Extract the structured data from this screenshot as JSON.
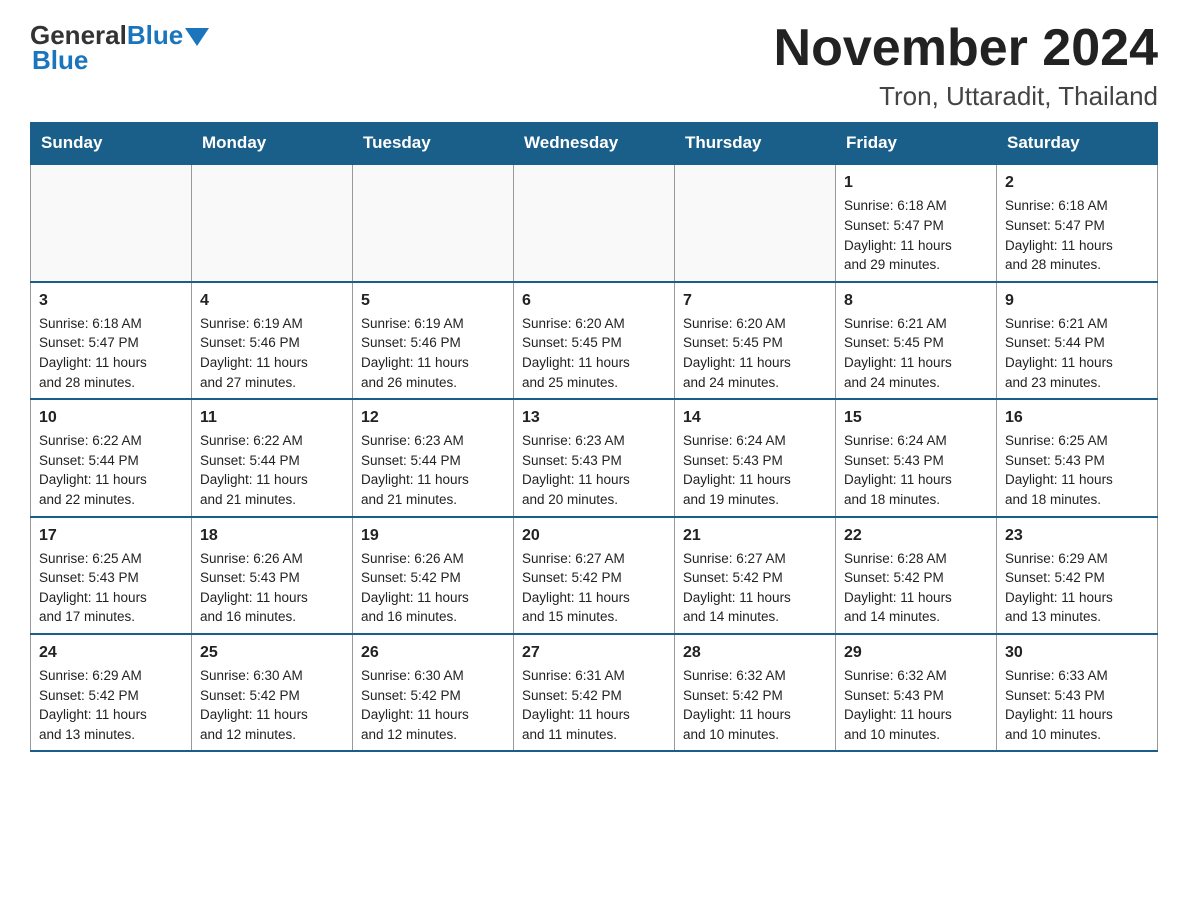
{
  "header": {
    "logo_general": "General",
    "logo_blue": "Blue",
    "month_title": "November 2024",
    "location": "Tron, Uttaradit, Thailand"
  },
  "days_of_week": [
    "Sunday",
    "Monday",
    "Tuesday",
    "Wednesday",
    "Thursday",
    "Friday",
    "Saturday"
  ],
  "weeks": [
    [
      {
        "day": "",
        "info": ""
      },
      {
        "day": "",
        "info": ""
      },
      {
        "day": "",
        "info": ""
      },
      {
        "day": "",
        "info": ""
      },
      {
        "day": "",
        "info": ""
      },
      {
        "day": "1",
        "info": "Sunrise: 6:18 AM\nSunset: 5:47 PM\nDaylight: 11 hours\nand 29 minutes."
      },
      {
        "day": "2",
        "info": "Sunrise: 6:18 AM\nSunset: 5:47 PM\nDaylight: 11 hours\nand 28 minutes."
      }
    ],
    [
      {
        "day": "3",
        "info": "Sunrise: 6:18 AM\nSunset: 5:47 PM\nDaylight: 11 hours\nand 28 minutes."
      },
      {
        "day": "4",
        "info": "Sunrise: 6:19 AM\nSunset: 5:46 PM\nDaylight: 11 hours\nand 27 minutes."
      },
      {
        "day": "5",
        "info": "Sunrise: 6:19 AM\nSunset: 5:46 PM\nDaylight: 11 hours\nand 26 minutes."
      },
      {
        "day": "6",
        "info": "Sunrise: 6:20 AM\nSunset: 5:45 PM\nDaylight: 11 hours\nand 25 minutes."
      },
      {
        "day": "7",
        "info": "Sunrise: 6:20 AM\nSunset: 5:45 PM\nDaylight: 11 hours\nand 24 minutes."
      },
      {
        "day": "8",
        "info": "Sunrise: 6:21 AM\nSunset: 5:45 PM\nDaylight: 11 hours\nand 24 minutes."
      },
      {
        "day": "9",
        "info": "Sunrise: 6:21 AM\nSunset: 5:44 PM\nDaylight: 11 hours\nand 23 minutes."
      }
    ],
    [
      {
        "day": "10",
        "info": "Sunrise: 6:22 AM\nSunset: 5:44 PM\nDaylight: 11 hours\nand 22 minutes."
      },
      {
        "day": "11",
        "info": "Sunrise: 6:22 AM\nSunset: 5:44 PM\nDaylight: 11 hours\nand 21 minutes."
      },
      {
        "day": "12",
        "info": "Sunrise: 6:23 AM\nSunset: 5:44 PM\nDaylight: 11 hours\nand 21 minutes."
      },
      {
        "day": "13",
        "info": "Sunrise: 6:23 AM\nSunset: 5:43 PM\nDaylight: 11 hours\nand 20 minutes."
      },
      {
        "day": "14",
        "info": "Sunrise: 6:24 AM\nSunset: 5:43 PM\nDaylight: 11 hours\nand 19 minutes."
      },
      {
        "day": "15",
        "info": "Sunrise: 6:24 AM\nSunset: 5:43 PM\nDaylight: 11 hours\nand 18 minutes."
      },
      {
        "day": "16",
        "info": "Sunrise: 6:25 AM\nSunset: 5:43 PM\nDaylight: 11 hours\nand 18 minutes."
      }
    ],
    [
      {
        "day": "17",
        "info": "Sunrise: 6:25 AM\nSunset: 5:43 PM\nDaylight: 11 hours\nand 17 minutes."
      },
      {
        "day": "18",
        "info": "Sunrise: 6:26 AM\nSunset: 5:43 PM\nDaylight: 11 hours\nand 16 minutes."
      },
      {
        "day": "19",
        "info": "Sunrise: 6:26 AM\nSunset: 5:42 PM\nDaylight: 11 hours\nand 16 minutes."
      },
      {
        "day": "20",
        "info": "Sunrise: 6:27 AM\nSunset: 5:42 PM\nDaylight: 11 hours\nand 15 minutes."
      },
      {
        "day": "21",
        "info": "Sunrise: 6:27 AM\nSunset: 5:42 PM\nDaylight: 11 hours\nand 14 minutes."
      },
      {
        "day": "22",
        "info": "Sunrise: 6:28 AM\nSunset: 5:42 PM\nDaylight: 11 hours\nand 14 minutes."
      },
      {
        "day": "23",
        "info": "Sunrise: 6:29 AM\nSunset: 5:42 PM\nDaylight: 11 hours\nand 13 minutes."
      }
    ],
    [
      {
        "day": "24",
        "info": "Sunrise: 6:29 AM\nSunset: 5:42 PM\nDaylight: 11 hours\nand 13 minutes."
      },
      {
        "day": "25",
        "info": "Sunrise: 6:30 AM\nSunset: 5:42 PM\nDaylight: 11 hours\nand 12 minutes."
      },
      {
        "day": "26",
        "info": "Sunrise: 6:30 AM\nSunset: 5:42 PM\nDaylight: 11 hours\nand 12 minutes."
      },
      {
        "day": "27",
        "info": "Sunrise: 6:31 AM\nSunset: 5:42 PM\nDaylight: 11 hours\nand 11 minutes."
      },
      {
        "day": "28",
        "info": "Sunrise: 6:32 AM\nSunset: 5:42 PM\nDaylight: 11 hours\nand 10 minutes."
      },
      {
        "day": "29",
        "info": "Sunrise: 6:32 AM\nSunset: 5:43 PM\nDaylight: 11 hours\nand 10 minutes."
      },
      {
        "day": "30",
        "info": "Sunrise: 6:33 AM\nSunset: 5:43 PM\nDaylight: 11 hours\nand 10 minutes."
      }
    ]
  ]
}
